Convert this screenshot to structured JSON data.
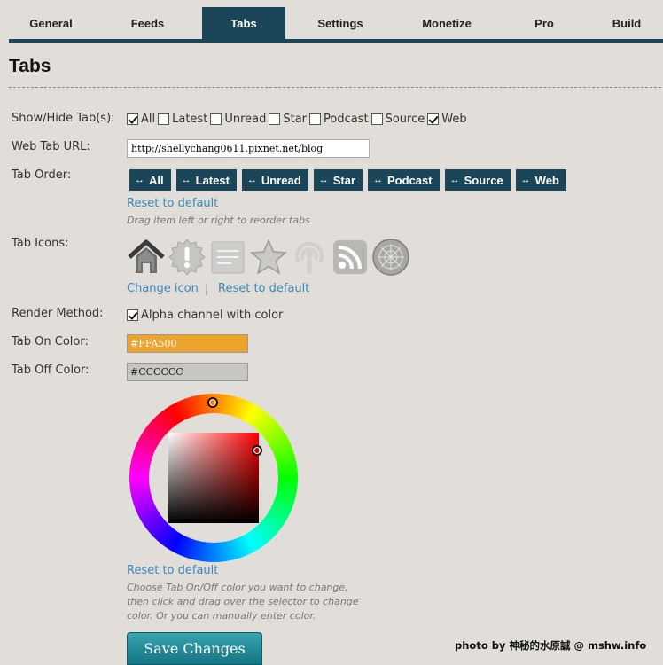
{
  "nav": {
    "tabs": [
      {
        "label": "General"
      },
      {
        "label": "Feeds"
      },
      {
        "label": "Tabs"
      },
      {
        "label": "Settings"
      },
      {
        "label": "Monetize"
      },
      {
        "label": "Pro"
      },
      {
        "label": "Build"
      }
    ],
    "active": "Tabs"
  },
  "page": {
    "title": "Tabs"
  },
  "show_hide": {
    "label": "Show/Hide Tab(s):",
    "options": [
      {
        "label": "All",
        "checked": true
      },
      {
        "label": "Latest",
        "checked": false
      },
      {
        "label": "Unread",
        "checked": false
      },
      {
        "label": "Star",
        "checked": false
      },
      {
        "label": "Podcast",
        "checked": false
      },
      {
        "label": "Source",
        "checked": false
      },
      {
        "label": "Web",
        "checked": true
      }
    ]
  },
  "web_url": {
    "label": "Web Tab URL:",
    "value": "http://shellychang0611.pixnet.net/blog"
  },
  "tab_order": {
    "label": "Tab Order:",
    "arrow": "↔",
    "items": [
      "All",
      "Latest",
      "Unread",
      "Star",
      "Podcast",
      "Source",
      "Web"
    ],
    "reset_label": "Reset to default",
    "hint": "Drag item left or right to reorder tabs"
  },
  "tab_icons": {
    "label": "Tab Icons:",
    "icons": [
      "home-icon",
      "alert-badge-icon",
      "note-icon",
      "star-icon",
      "podcast-icon",
      "rss-icon",
      "web-icon"
    ],
    "change_label": "Change icon",
    "separator": "|",
    "reset_label": "Reset to default"
  },
  "render_method": {
    "label": "Render Method:",
    "option": "Alpha channel with color",
    "checked": true
  },
  "tab_on_color": {
    "label": "Tab On Color:",
    "value": "#FFA500",
    "color": "#eda32c"
  },
  "tab_off_color": {
    "label": "Tab Off Color:",
    "value": "#CCCCCC",
    "color": "#c8c6c2"
  },
  "color_picker": {
    "reset_label": "Reset to default",
    "hint": [
      "Choose Tab On/Off color you want to change,",
      "then click and drag over the selector to change",
      "color. Or you can manually enter color."
    ]
  },
  "save_button": {
    "label": "Save Changes"
  },
  "watermark": {
    "text": "photo by 神秘的水原誠 @ mshw.info"
  },
  "colors": {
    "accent": "#1b4559",
    "link": "#3a86b8",
    "background": "#e1ded9"
  }
}
